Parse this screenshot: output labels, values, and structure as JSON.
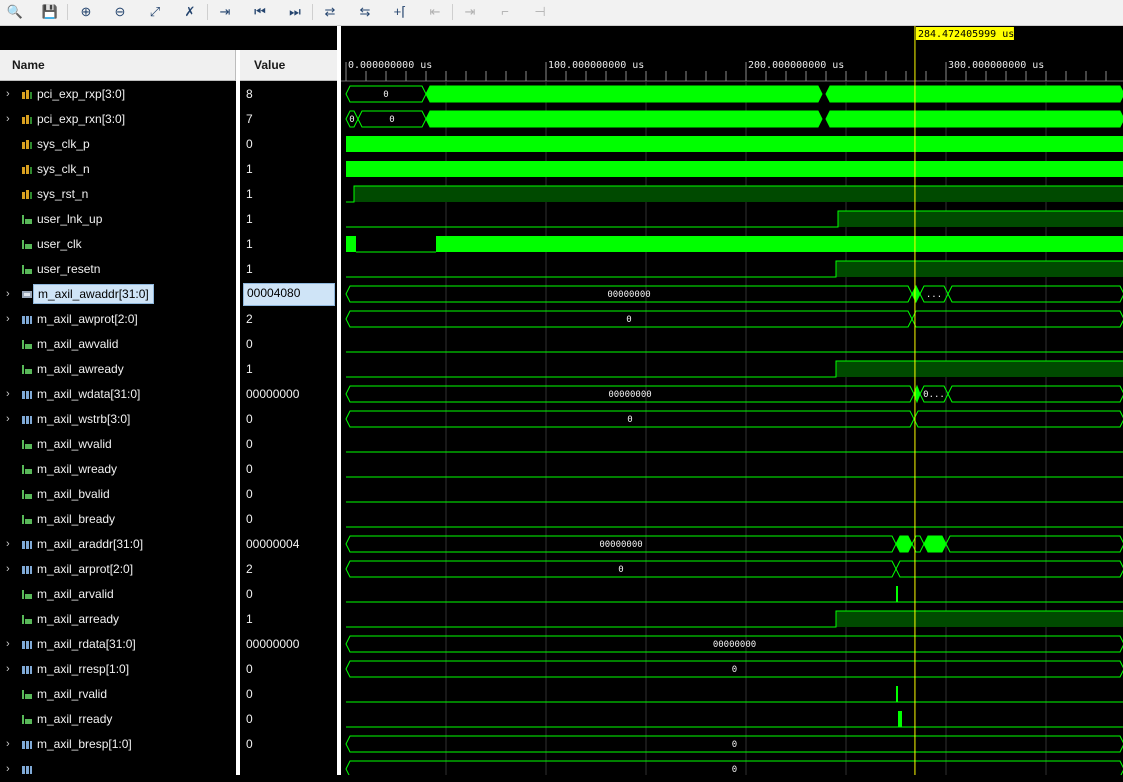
{
  "toolbar": [
    {
      "name": "search-icon",
      "glyph": "🔍",
      "enabled": true
    },
    {
      "name": "save-icon",
      "glyph": "💾",
      "enabled": true
    },
    {
      "name": "zoom-in-icon",
      "glyph": "⊕",
      "enabled": true
    },
    {
      "name": "zoom-out-icon",
      "glyph": "⊖",
      "enabled": true
    },
    {
      "name": "zoom-fit-icon",
      "glyph": "⤢",
      "enabled": true
    },
    {
      "name": "zoom-to-cursor-icon",
      "glyph": "✗",
      "enabled": true
    },
    {
      "name": "go-to-cursor-icon",
      "glyph": "⇥",
      "enabled": true
    },
    {
      "name": "go-to-time-0-icon",
      "glyph": "⏮",
      "enabled": true
    },
    {
      "name": "go-to-last-time-icon",
      "glyph": "⏭",
      "enabled": true
    },
    {
      "name": "swap-cursors-icon",
      "glyph": "⇄",
      "enabled": true
    },
    {
      "name": "cycle-markers-icon",
      "glyph": "⇆",
      "enabled": true
    },
    {
      "name": "add-marker-icon",
      "glyph": "+⌈",
      "enabled": true
    },
    {
      "name": "previous-marker-icon",
      "glyph": "⇤",
      "enabled": false
    },
    {
      "name": "next-marker-icon",
      "glyph": "⇥",
      "enabled": false
    },
    {
      "name": "previous-transition-icon",
      "glyph": "⌐",
      "enabled": false
    },
    {
      "name": "next-transition-icon",
      "glyph": "⊣",
      "enabled": false
    }
  ],
  "header": {
    "name": "Name",
    "value": "Value"
  },
  "timeline": {
    "cursor_label": "284.472405999 us",
    "cursor_time_us": 284.472405999,
    "view_start_us": 0,
    "view_end_us": 389,
    "major_ticks_us": [
      0,
      100,
      200,
      300
    ],
    "major_labels": [
      "0.000000000 us",
      "100.000000000 us",
      "200.000000000 us",
      "300.000000000 us"
    ]
  },
  "colors": {
    "wave": "#00ff00",
    "wave_dim": "#00a000",
    "background": "#000000",
    "cursor": "#ffff00",
    "grid": "#303030"
  },
  "signals": [
    {
      "name": "pci_exp_rxp[3:0]",
      "value": "8",
      "kind": "bus",
      "expandable": true,
      "icon": "input-bus-icon",
      "segments": [
        {
          "from": 0,
          "to": 40,
          "label": "0",
          "fill": false
        },
        {
          "from": 40,
          "to": 238,
          "label": "",
          "fill": true
        },
        {
          "from": 240,
          "to": 389,
          "label": "",
          "fill": true
        }
      ]
    },
    {
      "name": "pci_exp_rxn[3:0]",
      "value": "7",
      "kind": "bus",
      "expandable": true,
      "icon": "input-bus-icon",
      "segments": [
        {
          "from": 0,
          "to": 6,
          "label": "0",
          "fill": false
        },
        {
          "from": 6,
          "to": 40,
          "label": "0",
          "fill": false
        },
        {
          "from": 40,
          "to": 238,
          "label": "",
          "fill": true
        },
        {
          "from": 240,
          "to": 389,
          "label": "",
          "fill": true
        }
      ]
    },
    {
      "name": "sys_clk_p",
      "value": "0",
      "kind": "clock",
      "expandable": false,
      "icon": "input-bit-icon",
      "clock_from": 0
    },
    {
      "name": "sys_clk_n",
      "value": "1",
      "kind": "clock",
      "expandable": false,
      "icon": "input-bit-icon",
      "clock_from": 0
    },
    {
      "name": "sys_rst_n",
      "value": "1",
      "kind": "bit",
      "expandable": false,
      "icon": "input-bit-icon",
      "edges": [
        4
      ],
      "initial": 0
    },
    {
      "name": "user_lnk_up",
      "value": "1",
      "kind": "bit",
      "expandable": false,
      "icon": "output-bit-icon",
      "edges": [
        246
      ],
      "initial": 0
    },
    {
      "name": "user_clk",
      "value": "1",
      "kind": "clock",
      "expandable": false,
      "icon": "output-bit-icon",
      "clock_from": 45,
      "pre_pulse": [
        0,
        5
      ]
    },
    {
      "name": "user_resetn",
      "value": "1",
      "kind": "bit",
      "expandable": false,
      "icon": "output-bit-icon",
      "edges": [
        245
      ],
      "initial": 0
    },
    {
      "name": "m_axil_awaddr[31:0]",
      "value": "00004080",
      "kind": "bus",
      "expandable": true,
      "icon": "bus-selected-icon",
      "selected": true,
      "segments": [
        {
          "from": 0,
          "to": 283,
          "label": "00000000",
          "fill": false
        },
        {
          "from": 283,
          "to": 287,
          "label": "",
          "fill": true
        },
        {
          "from": 287,
          "to": 301,
          "label": "...",
          "fill": false
        },
        {
          "from": 301,
          "to": 389,
          "label": "",
          "fill": false
        }
      ]
    },
    {
      "name": "m_axil_awprot[2:0]",
      "value": "2",
      "kind": "bus",
      "expandable": true,
      "icon": "output-bus-icon",
      "segments": [
        {
          "from": 0,
          "to": 283,
          "label": "0",
          "fill": false
        },
        {
          "from": 283,
          "to": 389,
          "label": "",
          "fill": false
        }
      ]
    },
    {
      "name": "m_axil_awvalid",
      "value": "0",
      "kind": "bit",
      "expandable": false,
      "icon": "output-bit-icon",
      "edges": [],
      "initial": 0
    },
    {
      "name": "m_axil_awready",
      "value": "1",
      "kind": "bit",
      "expandable": false,
      "icon": "output-bit-icon",
      "edges": [
        245
      ],
      "initial": 0
    },
    {
      "name": "m_axil_wdata[31:0]",
      "value": "00000000",
      "kind": "bus",
      "expandable": true,
      "icon": "output-bus-icon",
      "segments": [
        {
          "from": 0,
          "to": 284,
          "label": "00000000",
          "fill": false
        },
        {
          "from": 284,
          "to": 287,
          "label": "",
          "fill": true
        },
        {
          "from": 287,
          "to": 301,
          "label": "0...",
          "fill": false
        },
        {
          "from": 301,
          "to": 389,
          "label": "",
          "fill": false
        }
      ]
    },
    {
      "name": "m_axil_wstrb[3:0]",
      "value": "0",
      "kind": "bus",
      "expandable": true,
      "icon": "output-bus-icon",
      "segments": [
        {
          "from": 0,
          "to": 284,
          "label": "0",
          "fill": false
        },
        {
          "from": 284,
          "to": 389,
          "label": "",
          "fill": false
        }
      ]
    },
    {
      "name": "m_axil_wvalid",
      "value": "0",
      "kind": "bit",
      "expandable": false,
      "icon": "output-bit-icon",
      "edges": [],
      "initial": 0
    },
    {
      "name": "m_axil_wready",
      "value": "0",
      "kind": "bit",
      "expandable": false,
      "icon": "output-bit-icon",
      "edges": [],
      "initial": 0
    },
    {
      "name": "m_axil_bvalid",
      "value": "0",
      "kind": "bit",
      "expandable": false,
      "icon": "output-bit-icon",
      "edges": [],
      "initial": 0
    },
    {
      "name": "m_axil_bready",
      "value": "0",
      "kind": "bit",
      "expandable": false,
      "icon": "output-bit-icon",
      "edges": [],
      "initial": 0
    },
    {
      "name": "m_axil_araddr[31:0]",
      "value": "00000004",
      "kind": "bus",
      "expandable": true,
      "icon": "output-bus-icon",
      "segments": [
        {
          "from": 0,
          "to": 275,
          "label": "00000000",
          "fill": false
        },
        {
          "from": 275,
          "to": 283,
          "label": "",
          "fill": true
        },
        {
          "from": 283,
          "to": 289,
          "label": "",
          "fill": false
        },
        {
          "from": 289,
          "to": 300,
          "label": "",
          "fill": true
        },
        {
          "from": 300,
          "to": 389,
          "label": "",
          "fill": false
        }
      ]
    },
    {
      "name": "m_axil_arprot[2:0]",
      "value": "2",
      "kind": "bus",
      "expandable": true,
      "icon": "output-bus-icon",
      "segments": [
        {
          "from": 0,
          "to": 275,
          "label": "0",
          "fill": false
        },
        {
          "from": 275,
          "to": 389,
          "label": "",
          "fill": false
        }
      ]
    },
    {
      "name": "m_axil_arvalid",
      "value": "0",
      "kind": "bit",
      "expandable": false,
      "icon": "output-bit-icon",
      "edges": [],
      "initial": 0,
      "pulses": [
        [
          275,
          276
        ]
      ]
    },
    {
      "name": "m_axil_arready",
      "value": "1",
      "kind": "bit",
      "expandable": false,
      "icon": "output-bit-icon",
      "edges": [
        245
      ],
      "initial": 0
    },
    {
      "name": "m_axil_rdata[31:0]",
      "value": "00000000",
      "kind": "bus",
      "expandable": true,
      "icon": "output-bus-icon",
      "segments": [
        {
          "from": 0,
          "to": 389,
          "label": "00000000",
          "fill": false
        }
      ]
    },
    {
      "name": "m_axil_rresp[1:0]",
      "value": "0",
      "kind": "bus",
      "expandable": true,
      "icon": "output-bus-icon",
      "segments": [
        {
          "from": 0,
          "to": 389,
          "label": "0",
          "fill": false
        }
      ]
    },
    {
      "name": "m_axil_rvalid",
      "value": "0",
      "kind": "bit",
      "expandable": false,
      "icon": "output-bit-icon",
      "edges": [],
      "initial": 0,
      "pulses": [
        [
          275,
          276
        ]
      ]
    },
    {
      "name": "m_axil_rready",
      "value": "0",
      "kind": "bit",
      "expandable": false,
      "icon": "output-bit-icon",
      "edges": [],
      "initial": 0,
      "pulses": [
        [
          276,
          278
        ]
      ]
    },
    {
      "name": "m_axil_bresp[1:0]",
      "value": "0",
      "kind": "bus",
      "expandable": true,
      "icon": "output-bus-icon",
      "segments": [
        {
          "from": 0,
          "to": 389,
          "label": "0",
          "fill": false
        }
      ]
    },
    {
      "name": "",
      "value": "",
      "kind": "bus",
      "expandable": true,
      "icon": "output-bus-icon",
      "segments": [
        {
          "from": 0,
          "to": 389,
          "label": "0",
          "fill": false
        }
      ]
    }
  ]
}
